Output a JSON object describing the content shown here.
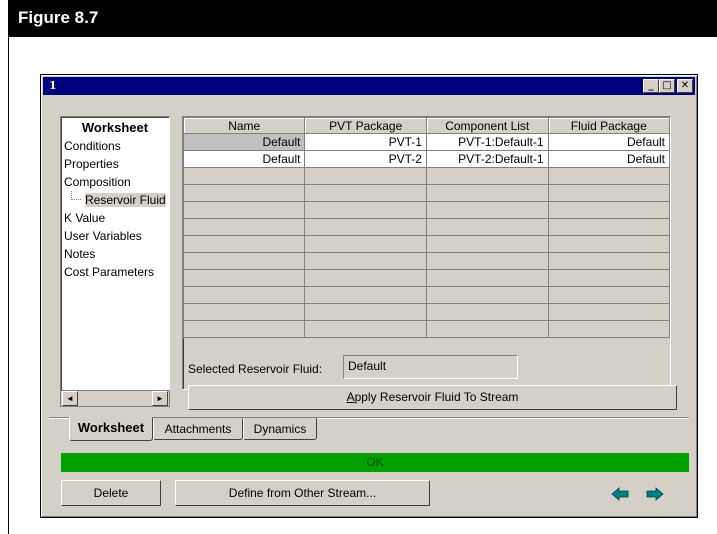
{
  "figure": {
    "title": "Figure 8.7"
  },
  "window": {
    "title": "1",
    "minimize": "_",
    "maximize": "□",
    "close": "✕"
  },
  "sidebar": {
    "title": "Worksheet",
    "items": [
      {
        "label": "Conditions"
      },
      {
        "label": "Properties"
      },
      {
        "label": "Composition"
      },
      {
        "label": "Reservoir Fluid",
        "child": true,
        "selected": true
      },
      {
        "label": "K Value"
      },
      {
        "label": "User Variables"
      },
      {
        "label": "Notes"
      },
      {
        "label": "Cost Parameters"
      }
    ],
    "scroll_left": "◄",
    "scroll_right": "►"
  },
  "grid": {
    "columns": [
      "Name",
      "PVT Package",
      "Component List",
      "Fluid Package"
    ],
    "rows": [
      [
        "Default",
        "PVT-1",
        "PVT-1:Default-1",
        "Default"
      ],
      [
        "Default",
        "PVT-2",
        "PVT-2:Default-1",
        "Default"
      ]
    ],
    "empty_rows": 10
  },
  "selected_fluid": {
    "label": "Selected Reservoir Fluid:",
    "value": "Default"
  },
  "apply_button": {
    "accesskey": "A",
    "label_rest": "pply Reservoir Fluid To Stream"
  },
  "tabs": [
    "Worksheet",
    "Attachments",
    "Dynamics"
  ],
  "status": {
    "text": "OK",
    "color": "#00a000"
  },
  "bottom": {
    "delete_label": "Delete",
    "define_label": "Define from Other Stream...",
    "back_icon": "left-arrow-icon",
    "forward_icon": "right-arrow-icon",
    "arrow_color": "#008080"
  }
}
